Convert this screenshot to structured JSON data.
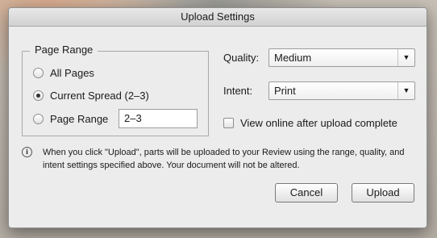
{
  "dialog": {
    "title": "Upload Settings",
    "page_range": {
      "legend": "Page Range",
      "options": [
        {
          "label": "All Pages",
          "selected": false
        },
        {
          "label": "Current Spread (2–3)",
          "selected": true
        },
        {
          "label": "Page Range",
          "selected": false
        }
      ],
      "range_input_value": "2–3"
    },
    "quality": {
      "label": "Quality:",
      "value": "Medium"
    },
    "intent": {
      "label": "Intent:",
      "value": "Print"
    },
    "view_online": {
      "label": "View online after upload complete",
      "checked": false
    },
    "info_icon": "info-circle-icon",
    "note": "When you click \"Upload\", parts will be uploaded to your Review using the range, quality, and intent settings specified above. Your document will not be altered.",
    "buttons": {
      "cancel": "Cancel",
      "upload": "Upload"
    }
  }
}
